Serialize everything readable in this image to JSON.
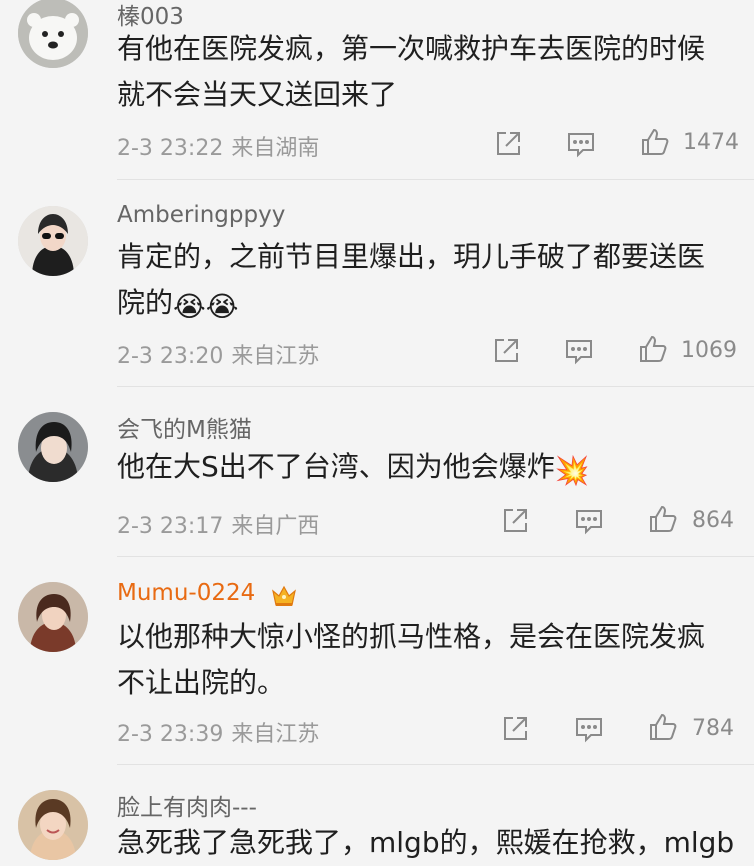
{
  "comments": [
    {
      "username": "榛003",
      "text": "有他在医院发疯，第一次喊救护车去医院的时候就不会当天又送回来了",
      "date": "2-3 23:22",
      "location": "来自湖南",
      "likes": "1474",
      "avatar_icon": "polar-bear-avatar"
    },
    {
      "username": "Amberingppyy",
      "text": "肯定的，之前节目里爆出，玥儿手破了都要送医院的",
      "emoji": "😭😭",
      "date": "2-3 23:20",
      "location": "来自江苏",
      "likes": "1069",
      "avatar_icon": "girl-sunglasses-avatar"
    },
    {
      "username": "会飞的M熊猫",
      "text": "他在大S出不了台湾、因为他会爆炸",
      "emoji": "💥",
      "date": "2-3 23:17",
      "location": "来自广西",
      "likes": "864",
      "avatar_icon": "girl-portrait-avatar"
    },
    {
      "username": "Mumu-0224",
      "text": "以他那种大惊小怪的抓马性格，是会在医院发疯不让出院的。",
      "date": "2-3 23:39",
      "location": "来自江苏",
      "likes": "784",
      "avatar_icon": "woman-portrait-avatar",
      "badge_icon": "crown-icon"
    },
    {
      "username": "脸上有肉肉---",
      "text": "急死我了急死我了，mlgb的，熙媛在抢救，mlgb",
      "avatar_icon": "smiling-woman-avatar"
    }
  ],
  "colors": {
    "background": "#f4f4f4",
    "vip_name": "#e86a12",
    "meta": "#9a9a9a"
  }
}
